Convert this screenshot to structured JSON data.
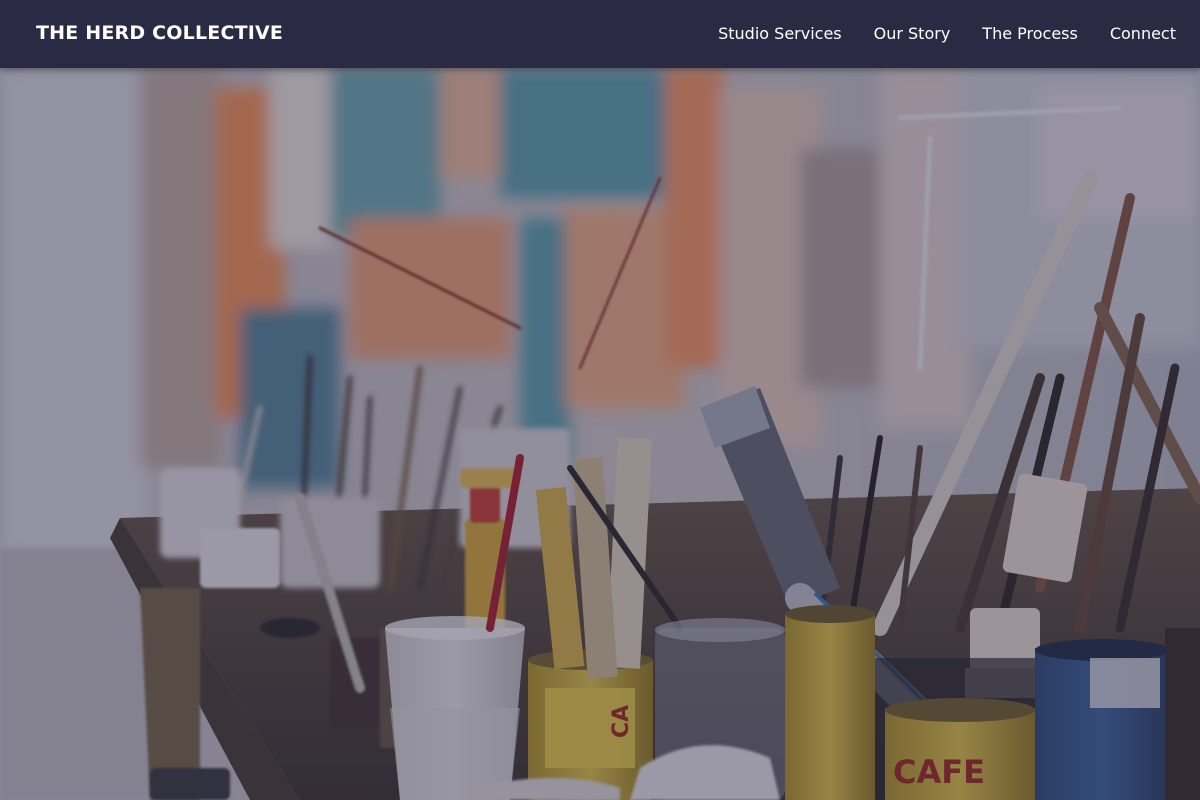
{
  "brand": {
    "name": "THE HERD COLLECTIVE"
  },
  "nav": {
    "items": [
      {
        "label": "Studio Services"
      },
      {
        "label": "Our Story"
      },
      {
        "label": "The Process"
      },
      {
        "label": "Connect"
      }
    ]
  },
  "hero": {
    "image": "painter-studio-brushes-and-paint-cans",
    "overlay_color": "#262440"
  },
  "colors": {
    "navbar": "#2b2a44",
    "text": "#ffffff"
  }
}
